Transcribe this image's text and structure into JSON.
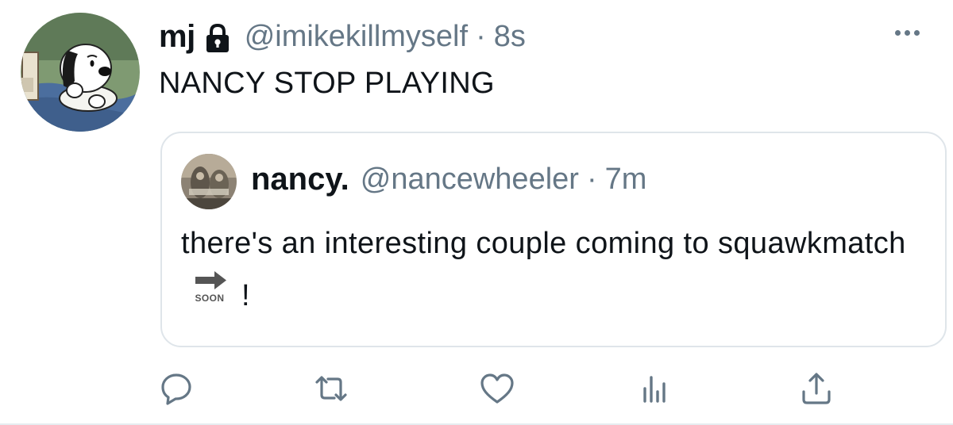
{
  "tweet": {
    "author_name": "mj",
    "author_handle": "@imikekillmyself",
    "separator": "·",
    "time": "8s",
    "text": "NANCY STOP PLAYING",
    "avatar_icon": "cartoon-dog-avatar",
    "protected_icon": "lock-icon",
    "more_icon": "more-horizontal-icon"
  },
  "quote": {
    "author_name": "nancy.",
    "author_handle": "@nancewheeler",
    "separator": "·",
    "time": "7m",
    "text_before": "there's an interesting couple coming to squawkmatch",
    "emoji_name": "soon-arrow-emoji",
    "emoji_label": "SOON",
    "text_after": "!"
  },
  "actions": [
    {
      "name": "reply",
      "icon": "reply-icon"
    },
    {
      "name": "retweet",
      "icon": "retweet-icon"
    },
    {
      "name": "like",
      "icon": "heart-icon"
    },
    {
      "name": "analytics",
      "icon": "analytics-icon"
    },
    {
      "name": "share",
      "icon": "share-icon"
    }
  ],
  "colors": {
    "text_primary": "#0f1419",
    "text_secondary": "#657786",
    "border": "#dfe5ea"
  }
}
